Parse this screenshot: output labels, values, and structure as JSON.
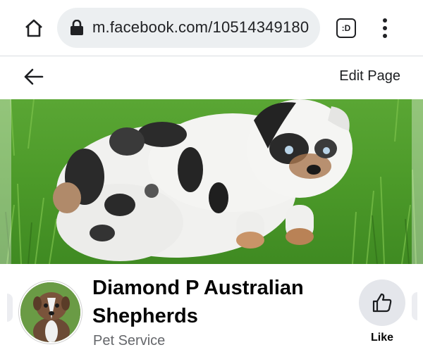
{
  "browser": {
    "url": "m.facebook.com/10514349180",
    "tab_switcher_label": ":D",
    "icons": [
      "home-icon",
      "lock-icon",
      "tab-switcher-icon",
      "more-vert-icon"
    ]
  },
  "header": {
    "back_icon": "arrow-left-icon",
    "edit_page_label": "Edit Page"
  },
  "cover": {
    "description_icon": "cover-photo"
  },
  "profile": {
    "name": "Diamond P Australian Shepherds",
    "category": "Pet Service",
    "like_label": "Like",
    "like_icon": "thumbs-up-icon"
  },
  "colors": {
    "url_bar_bg": "#eceff1",
    "like_button_bg": "#e4e6eb",
    "secondary_text": "#65676b"
  }
}
